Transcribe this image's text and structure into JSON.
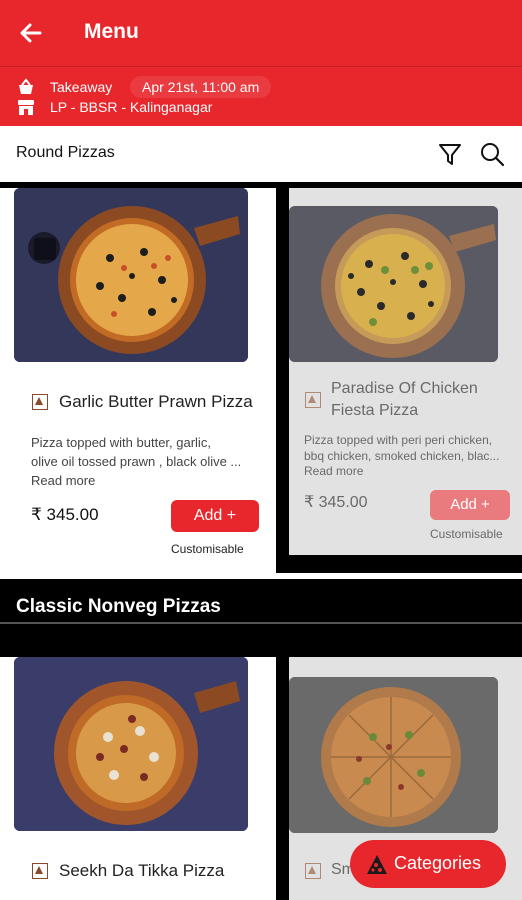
{
  "header": {
    "title": "Menu",
    "back_icon": "arrow-left-icon"
  },
  "order_info": {
    "mode": "Takeaway",
    "datetime": "Apr 21st, 11:00 am",
    "store": "LP - BBSR - Kalinganagar",
    "mode_icon": "basket-icon",
    "store_icon": "store-icon"
  },
  "section1": {
    "title": "Round Pizzas",
    "filter_icon": "filter-icon",
    "search_icon": "search-icon"
  },
  "items": [
    {
      "name": "Garlic Butter Prawn Pizza",
      "desc_line1": "Pizza topped with butter, garlic,",
      "desc_line2": "olive oil tossed prawn , black olive ...",
      "read_more": "Read more",
      "price": "₹ 345.00",
      "add": "Add +",
      "custom": "Customisable"
    },
    {
      "name_line1": "Paradise Of Chicken",
      "name_line2": "Fiesta Pizza",
      "desc_line1": "Pizza topped with peri peri chicken,",
      "desc_line2": "bbq chicken, smoked chicken, blac...",
      "read_more": "Read more",
      "price": "₹ 345.00",
      "add": "Add +",
      "custom": "Customisable"
    },
    {
      "name": "Seekh Da Tikka Pizza"
    },
    {
      "name": "Sm"
    }
  ],
  "section2": {
    "title": "Classic Nonveg Pizzas"
  },
  "fab": {
    "label": "Categories",
    "icon": "pizza-slice-icon"
  },
  "colors": {
    "brand": "#e8272d",
    "dark": "#000000"
  }
}
